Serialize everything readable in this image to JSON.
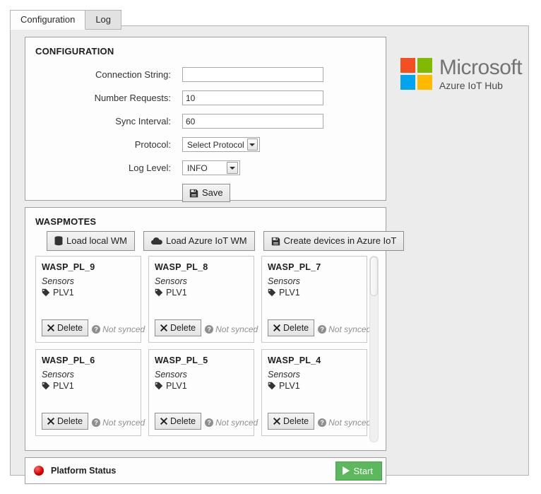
{
  "tabs": [
    {
      "label": "Configuration",
      "active": true
    },
    {
      "label": "Log",
      "active": false
    }
  ],
  "configuration": {
    "title": "CONFIGURATION",
    "fields": {
      "connection_string": {
        "label": "Connection String:",
        "value": "",
        "placeholder": ""
      },
      "number_requests": {
        "label": "Number Requests:",
        "value": "10"
      },
      "sync_interval": {
        "label": "Sync Interval:",
        "value": "60"
      },
      "protocol": {
        "label": "Protocol:",
        "value": "Select Protocol"
      },
      "log_level": {
        "label": "Log Level:",
        "value": "INFO"
      }
    },
    "save_label": "Save",
    "save_icon": "floppy-disk-icon"
  },
  "branding": {
    "word": "Microsoft",
    "subtitle": "Azure IoT Hub",
    "square_colors": [
      "#f25022",
      "#7fba00",
      "#00a4ef",
      "#ffb900"
    ]
  },
  "waspmotes": {
    "title": "WASPMOTES",
    "toolbar": [
      {
        "label": "Load local WM",
        "icon": "database-icon"
      },
      {
        "label": "Load Azure IoT WM",
        "icon": "cloud-icon"
      },
      {
        "label": "Create devices in Azure IoT",
        "icon": "floppy-disk-icon"
      }
    ],
    "sensors_label": "Sensors",
    "delete_label": "Delete",
    "delete_icon": "x-icon",
    "sync_status_label": "Not synced",
    "sync_status_icon": "question-circle-icon",
    "sensor_icon": "tag-icon",
    "cards": [
      {
        "name": "WASP_PL_9",
        "sensors": [
          "PLV1"
        ],
        "sync_status": "Not synced"
      },
      {
        "name": "WASP_PL_8",
        "sensors": [
          "PLV1"
        ],
        "sync_status": "Not synced"
      },
      {
        "name": "WASP_PL_7",
        "sensors": [
          "PLV1"
        ],
        "sync_status": "Not synced"
      },
      {
        "name": "WASP_PL_6",
        "sensors": [
          "PLV1"
        ],
        "sync_status": "Not synced"
      },
      {
        "name": "WASP_PL_5",
        "sensors": [
          "PLV1"
        ],
        "sync_status": "Not synced"
      },
      {
        "name": "WASP_PL_4",
        "sensors": [
          "PLV1"
        ],
        "sync_status": "Not synced"
      }
    ]
  },
  "status_bar": {
    "label": "Platform Status",
    "indicator_color": "#d40000",
    "start_label": "Start",
    "start_icon": "play-icon",
    "start_color": "#5cb85c"
  }
}
